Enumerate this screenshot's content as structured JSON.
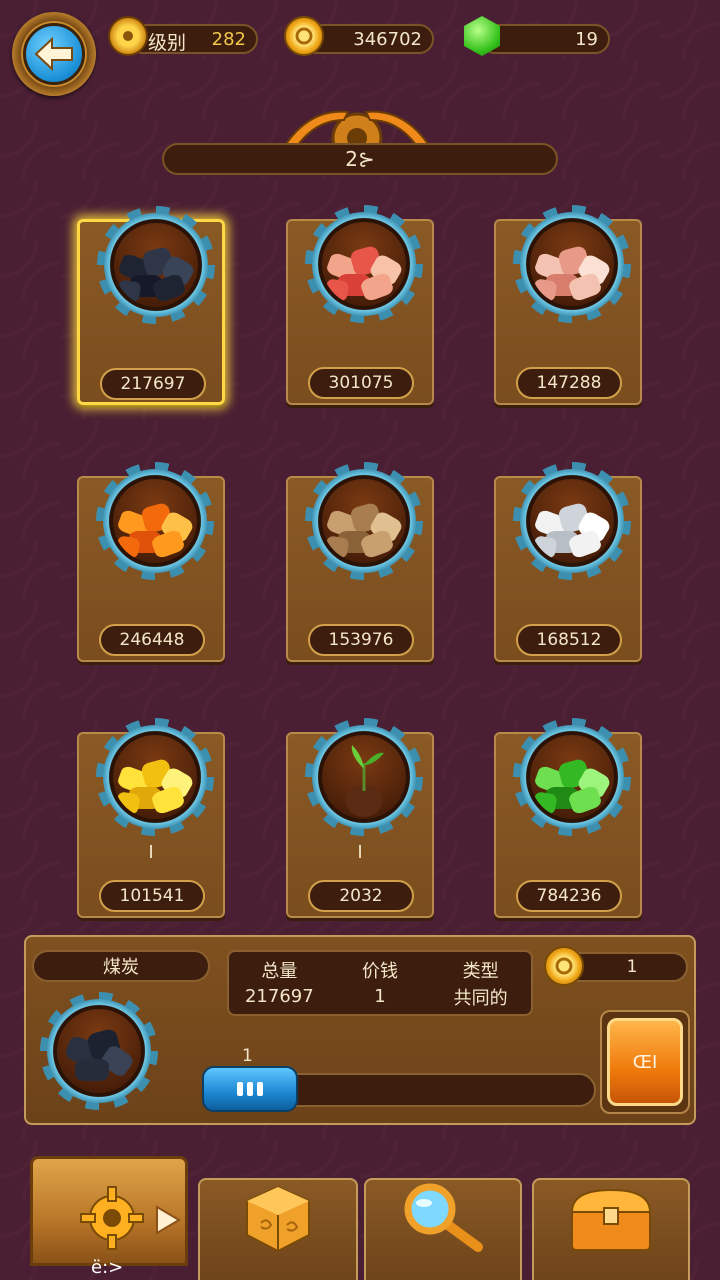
{
  "top_bar": {
    "level_label": "级别",
    "level_value": "282",
    "coins": "346702",
    "gems": "19"
  },
  "banner": {
    "title": "2⊱"
  },
  "cards": [
    {
      "count": "217697",
      "mark": "",
      "ore": "coal",
      "selected": true
    },
    {
      "count": "301075",
      "mark": "",
      "ore": "red-ore"
    },
    {
      "count": "147288",
      "mark": "",
      "ore": "pink-ore"
    },
    {
      "count": "246448",
      "mark": "",
      "ore": "amber"
    },
    {
      "count": "153976",
      "mark": "",
      "ore": "sponge-rock"
    },
    {
      "count": "168512",
      "mark": "",
      "ore": "white-stone"
    },
    {
      "count": "101541",
      "mark": "I",
      "ore": "gold-nuggets"
    },
    {
      "count": "2032",
      "mark": "I",
      "ore": "sprout"
    },
    {
      "count": "784236",
      "mark": "",
      "ore": "emerald"
    }
  ],
  "detail": {
    "name": "煤炭",
    "headers": [
      "总量",
      "价钱",
      "类型"
    ],
    "values": [
      "217697",
      "1",
      "共同的"
    ],
    "unit_price": "1",
    "quantity": "1",
    "quantity_fraction": 0,
    "sell_label": "ŒI"
  },
  "tabs": {
    "active_label": "ë:>",
    "items": [
      "gear-icon",
      "dice-icon",
      "magnifier-icon",
      "chest-icon"
    ]
  },
  "colors": {
    "background": "#4a1f33",
    "panel": "#7a4d1e",
    "accent_blue": "#1c86d2",
    "accent_orange": "#f07a0c",
    "highlight": "#ffd844"
  }
}
